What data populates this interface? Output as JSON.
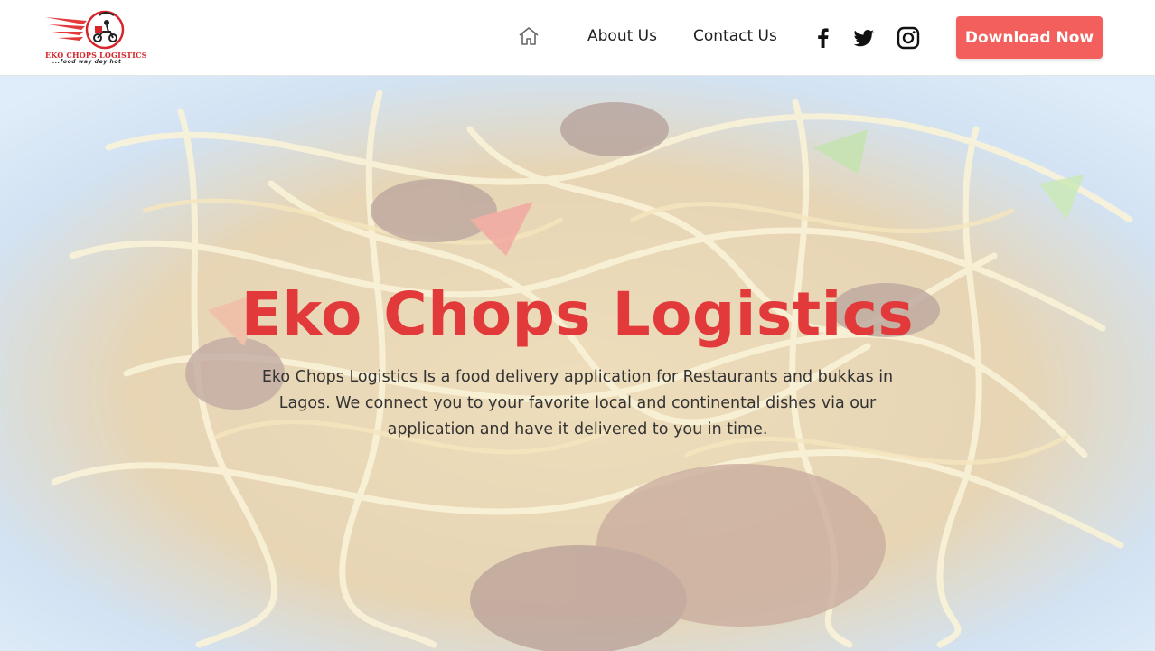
{
  "brand": {
    "name": "EKO CHOPS LOGISTICS",
    "tagline": "...food way dey hot",
    "accent_color": "#e2393b"
  },
  "nav": {
    "home_icon": "home-icon",
    "about_label": "About Us",
    "contact_label": "Contact Us"
  },
  "social": {
    "facebook_icon": "facebook-icon",
    "twitter_icon": "twitter-icon",
    "instagram_icon": "instagram-icon"
  },
  "cta": {
    "download_label": "Download Now",
    "color": "#f25f5c"
  },
  "hero": {
    "title": "Eko Chops Logistics",
    "description": "Eko Chops Logistics Is a food delivery application for Restaurants and bukkas in Lagos. We connect you to your favorite local and continental dishes via our application and have it delivered to you in time."
  }
}
